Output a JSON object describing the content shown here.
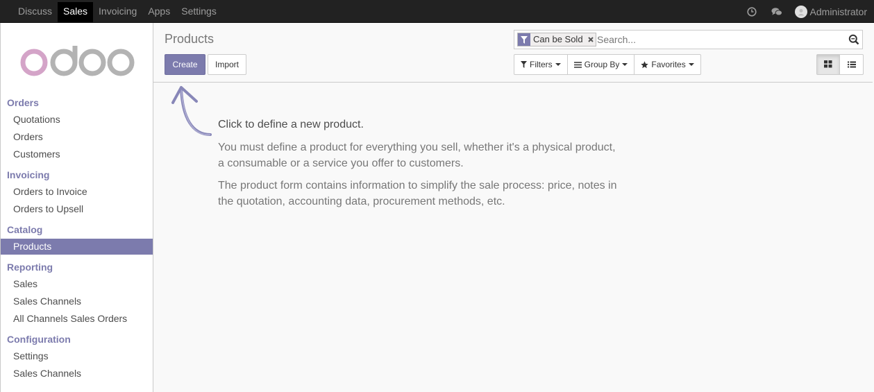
{
  "topbar": {
    "menu": [
      {
        "label": "Discuss",
        "active": false
      },
      {
        "label": "Sales",
        "active": true
      },
      {
        "label": "Invoicing",
        "active": false
      },
      {
        "label": "Apps",
        "active": false
      },
      {
        "label": "Settings",
        "active": false
      }
    ],
    "user": "Administrator"
  },
  "sidebar": {
    "sections": [
      {
        "title": "Orders",
        "items": [
          "Quotations",
          "Orders",
          "Customers"
        ]
      },
      {
        "title": "Invoicing",
        "items": [
          "Orders to Invoice",
          "Orders to Upsell"
        ]
      },
      {
        "title": "Catalog",
        "items": [
          "Products"
        ]
      },
      {
        "title": "Reporting",
        "items": [
          "Sales",
          "Sales Channels",
          "All Channels Sales Orders"
        ]
      },
      {
        "title": "Configuration",
        "items": [
          "Settings",
          "Sales Channels"
        ]
      }
    ],
    "active_item": "Products"
  },
  "control": {
    "title": "Products",
    "create_label": "Create",
    "import_label": "Import",
    "facet_label": "Can be Sold",
    "search_placeholder": "Search...",
    "filters_label": "Filters",
    "groupby_label": "Group By",
    "favorites_label": "Favorites"
  },
  "help": {
    "title": "Click to define a new product.",
    "p1_line1": "You must define a product for everything you sell, whether it's a physical product,",
    "p1_line2": "a consumable or a service you offer to customers.",
    "p2_line1": "The product form contains information to simplify the sale process: price, notes in",
    "p2_line2": "the quotation, accounting data, procurement methods, etc."
  },
  "colors": {
    "brand": "#7c7bad",
    "topbar": "#222222",
    "logo_o1": "#d4a4c8",
    "logo_gray": "#b3b3b3"
  },
  "icons": [
    "clock-icon",
    "chat-icon",
    "avatar",
    "filter-icon",
    "close-icon",
    "search-icon",
    "bars-icon",
    "star-icon",
    "kanban-icon",
    "list-icon",
    "arrow-icon"
  ]
}
